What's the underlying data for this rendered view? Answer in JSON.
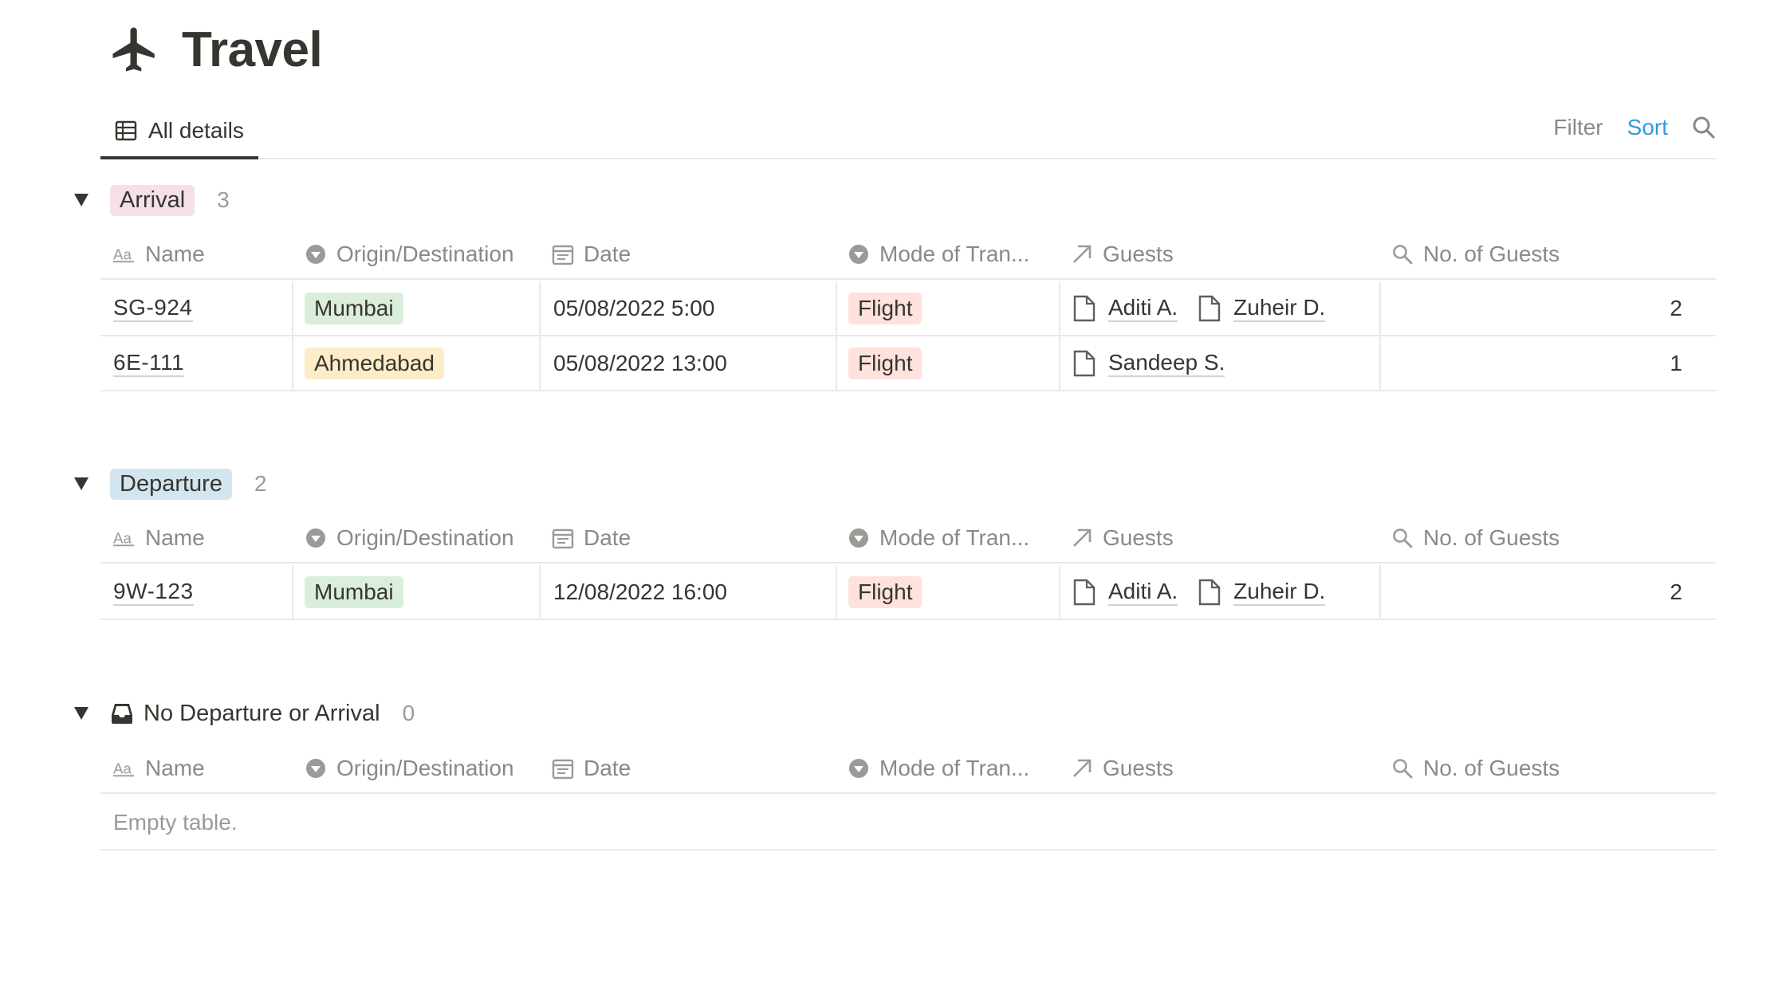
{
  "page": {
    "icon": "airplane-icon",
    "title": "Travel"
  },
  "view": {
    "tab_icon": "table-icon",
    "tab_label": "All details",
    "filter_label": "Filter",
    "sort_label": "Sort",
    "search_icon": "search-icon",
    "colors": {
      "sort": "#2f9ae0",
      "muted": "#8a8985"
    }
  },
  "columns": [
    {
      "icon": "text-aa-icon",
      "label": "Name"
    },
    {
      "icon": "select-circle-icon",
      "label": "Origin/Destination"
    },
    {
      "icon": "calendar-icon",
      "label": "Date"
    },
    {
      "icon": "select-circle-icon",
      "label": "Mode of Tran..."
    },
    {
      "icon": "relation-arrow-icon",
      "label": "Guests"
    },
    {
      "icon": "search-icon",
      "label": "No. of Guests"
    }
  ],
  "groups": [
    {
      "label": "Arrival",
      "count": "3",
      "tag_color": "#f5e0e9",
      "rows": [
        {
          "name": "SG-924",
          "origin": "Mumbai",
          "origin_color": "green",
          "date": "05/08/2022 5:00",
          "mode": "Flight",
          "guests": [
            "Aditi A.",
            "Zuheir D."
          ],
          "count": "2"
        },
        {
          "name": "6E-111",
          "origin": "Ahmedabad",
          "origin_color": "yellow",
          "date": "05/08/2022 13:00",
          "mode": "Flight",
          "guests": [
            "Sandeep S."
          ],
          "count": "1"
        }
      ]
    },
    {
      "label": "Departure",
      "count": "2",
      "tag_color": "#d3e5ef",
      "rows": [
        {
          "name": "9W-123",
          "origin": "Mumbai",
          "origin_color": "green",
          "date": "12/08/2022 16:00",
          "mode": "Flight",
          "guests": [
            "Aditi A.",
            "Zuheir D."
          ],
          "count": "2"
        }
      ]
    },
    {
      "label": "No Departure or Arrival",
      "count": "0",
      "icon": "inbox-tray-icon",
      "empty_text": "Empty table."
    }
  ]
}
